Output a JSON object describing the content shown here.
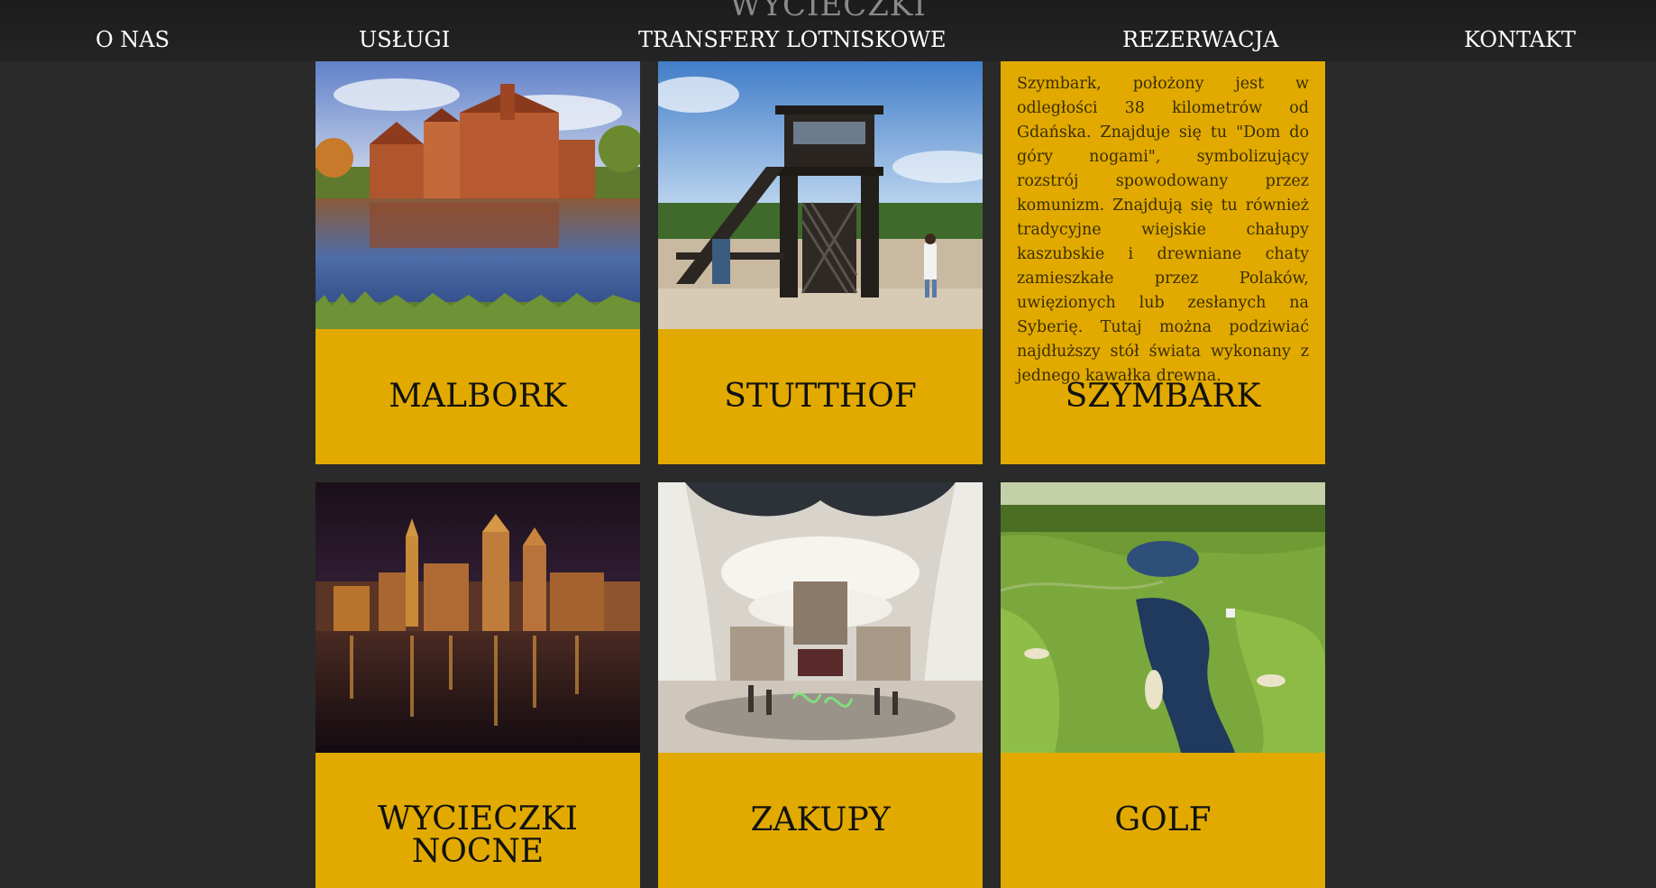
{
  "page": {
    "heading": "WYCIECZKI"
  },
  "nav": {
    "items": [
      "O NAS",
      "USŁUGI",
      "TRANSFERY LOTNISKOWE",
      "REZERWACJA",
      "KONTAKT"
    ]
  },
  "tiles": [
    {
      "title": "MALBORK"
    },
    {
      "title": "STUTTHOF"
    },
    {
      "title": "SZYMBARK",
      "description": "Szymbark, położony jest w odległości 38 kilometrów od Gdańska. Znajduje się tu \"Dom do góry nogami\", symbolizujący rozstrój spowodowany przez komunizm. Znajdują się tu również tradycyjne wiejskie chałupy kaszubskie i drewniane chaty zamieszkałe przez Polaków, uwięzionych lub zesłanych na Syberię. Tutaj można podziwiać najdłuższy stół świata wykonany z jednego kawałka drewna."
    },
    {
      "title": "WYCIECZKI NOCNE"
    },
    {
      "title": "ZAKUPY"
    },
    {
      "title": "GOLF"
    }
  ],
  "colors": {
    "background": "#2a2a2a",
    "tile": "#e2aa00",
    "nav_text": "#ffffff"
  }
}
